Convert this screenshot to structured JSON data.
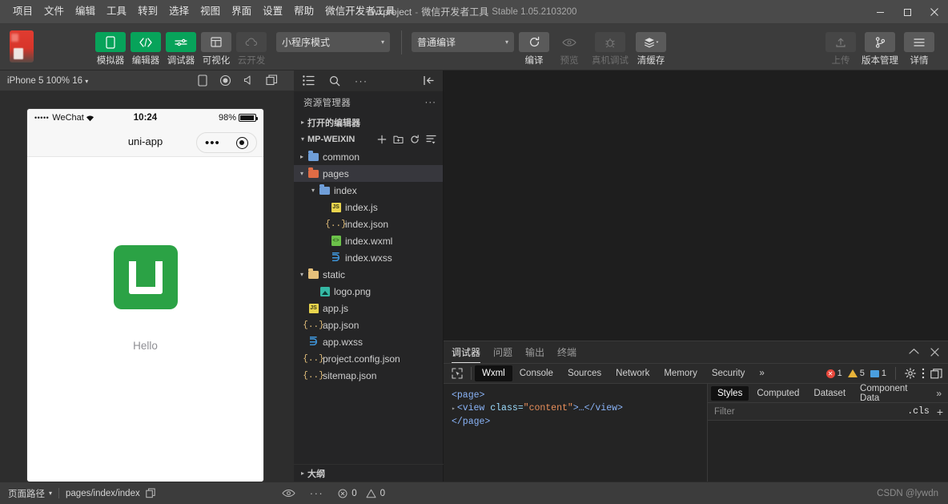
{
  "titlebar": {
    "menus": [
      "项目",
      "文件",
      "编辑",
      "工具",
      "转到",
      "选择",
      "视图",
      "界面",
      "设置",
      "帮助",
      "微信开发者工具"
    ],
    "project_name": "wxproject",
    "dash": "-",
    "app_name": "微信开发者工具",
    "version": "Stable 1.05.2103200",
    "controls": {
      "minimize": "minimize-icon",
      "maximize": "maximize-icon",
      "close": "close-icon"
    }
  },
  "toolbar": {
    "buttons": [
      {
        "label": "模拟器",
        "icon": "phone-icon",
        "state": "green"
      },
      {
        "label": "编辑器",
        "icon": "code-icon",
        "state": "green"
      },
      {
        "label": "调试器",
        "icon": "debug-icon",
        "state": "green"
      },
      {
        "label": "可视化",
        "icon": "layout-icon",
        "state": "grey"
      },
      {
        "label": "云开发",
        "icon": "cloud-icon",
        "state": "disabled"
      }
    ],
    "mode_select": {
      "value": "小程序模式",
      "caret": "▾"
    },
    "compile_select": {
      "value": "普通编译",
      "caret": "▾"
    },
    "actions": [
      {
        "label": "编译",
        "icon": "refresh-icon",
        "state": "normal"
      },
      {
        "label": "预览",
        "icon": "eye-icon",
        "state": "disabled"
      },
      {
        "label": "真机调试",
        "icon": "bug-icon",
        "state": "disabled"
      },
      {
        "label": "清缓存",
        "icon": "layers-icon",
        "state": "normal",
        "caret": "▾"
      }
    ],
    "right_actions": [
      {
        "label": "上传",
        "icon": "upload-icon",
        "state": "disabled"
      },
      {
        "label": "版本管理",
        "icon": "branch-icon",
        "state": "normal"
      },
      {
        "label": "详情",
        "icon": "menu-icon",
        "state": "normal"
      }
    ]
  },
  "simulator": {
    "device_label": "iPhone 5 100% 16",
    "device_caret": "▾",
    "icons": [
      "device-rotate-icon",
      "record-icon",
      "volume-icon",
      "window-icon"
    ],
    "phone": {
      "status": {
        "signal": "•••••",
        "carrier": "WeChat",
        "wifi": "wifi-icon",
        "time": "10:24",
        "battery_pct": "98%"
      },
      "nav_title": "uni-app",
      "capsule": {
        "dots": "•••",
        "target": "target-icon"
      },
      "content": {
        "logo": "uni-app-logo",
        "logo_color": "#2ba245",
        "text": "Hello"
      }
    }
  },
  "explorer": {
    "tool_icons": [
      "list-icon",
      "search-icon",
      "more-icon",
      "collapse-panel-icon"
    ],
    "header": "资源管理器",
    "header_more": "···",
    "sections": [
      {
        "label": "打开的编辑器",
        "expanded": false,
        "arrow": "▸"
      },
      {
        "label": "MP-WEIXIN",
        "expanded": true,
        "arrow": "▾",
        "actions": [
          "new-file-icon",
          "new-folder-icon",
          "refresh-icon",
          "collapse-all-icon"
        ]
      }
    ],
    "tree": [
      {
        "name": "common",
        "type": "folder",
        "color": "blue",
        "indent": 1,
        "arrow": "▸",
        "selected": false
      },
      {
        "name": "pages",
        "type": "folder",
        "color": "orange",
        "indent": 1,
        "arrow": "▾",
        "selected": true
      },
      {
        "name": "index",
        "type": "folder",
        "color": "blue",
        "indent": 2,
        "arrow": "▾",
        "selected": false
      },
      {
        "name": "index.js",
        "type": "js",
        "indent": 3,
        "arrow": "",
        "selected": false
      },
      {
        "name": "index.json",
        "type": "json",
        "indent": 3,
        "arrow": "",
        "selected": false
      },
      {
        "name": "index.wxml",
        "type": "wxml",
        "indent": 3,
        "arrow": "",
        "selected": false
      },
      {
        "name": "index.wxss",
        "type": "wxss",
        "indent": 3,
        "arrow": "",
        "selected": false
      },
      {
        "name": "static",
        "type": "folder",
        "color": "yellow",
        "indent": 1,
        "arrow": "▾",
        "selected": false
      },
      {
        "name": "logo.png",
        "type": "png",
        "indent": 2,
        "arrow": "",
        "selected": false
      },
      {
        "name": "app.js",
        "type": "js",
        "indent": 1,
        "arrow": "",
        "selected": false
      },
      {
        "name": "app.json",
        "type": "json",
        "indent": 1,
        "arrow": "",
        "selected": false
      },
      {
        "name": "app.wxss",
        "type": "wxss",
        "indent": 1,
        "arrow": "",
        "selected": false
      },
      {
        "name": "project.config.json",
        "type": "json",
        "indent": 1,
        "arrow": "",
        "selected": false
      },
      {
        "name": "sitemap.json",
        "type": "json",
        "indent": 1,
        "arrow": "",
        "selected": false
      }
    ],
    "outline": {
      "label": "大纲",
      "arrow": "▸"
    }
  },
  "debugger": {
    "panel_tabs": [
      {
        "label": "调试器",
        "active": true
      },
      {
        "label": "问题",
        "active": false
      },
      {
        "label": "输出",
        "active": false
      },
      {
        "label": "终端",
        "active": false
      }
    ],
    "panel_ctrls": [
      "collapse-icon",
      "close-icon"
    ],
    "devtools": {
      "inspect_icon": "inspect-element-icon",
      "tabs": [
        {
          "label": "Wxml",
          "active": true
        },
        {
          "label": "Console",
          "active": false
        },
        {
          "label": "Sources",
          "active": false
        },
        {
          "label": "Network",
          "active": false
        },
        {
          "label": "Memory",
          "active": false
        },
        {
          "label": "Security",
          "active": false
        }
      ],
      "overflow": "»",
      "counts": {
        "errors": "1",
        "warnings": "5",
        "infos": "1"
      },
      "right_icons": [
        "settings-icon",
        "kebab-menu-icon",
        "dock-icon"
      ]
    },
    "wxml": {
      "line1_open": "<page>",
      "line2_arrow": "▸",
      "line2_tag_open": "<view ",
      "line2_attr": "class=",
      "line2_value": "\"content\"",
      "line2_tag_close": ">…</view>",
      "line3_close": "</page>"
    },
    "styles": {
      "tabs": [
        {
          "label": "Styles",
          "active": true
        },
        {
          "label": "Computed",
          "active": false
        },
        {
          "label": "Dataset",
          "active": false
        },
        {
          "label": "Component Data",
          "active": false
        }
      ],
      "overflow": "»",
      "filter_placeholder": "Filter",
      "filter_value": "",
      "cls_label": ".cls",
      "plus_label": "+"
    }
  },
  "statusbar": {
    "page_path_label": "页面路径",
    "page_path_caret": "▾",
    "page_path_value": "pages/index/index",
    "copy_icon": "copy-icon",
    "right_icons": [
      "eye-icon",
      "more-icon"
    ],
    "problems": {
      "errors": "0",
      "warnings": "0"
    },
    "watermark": "CSDN @lywdn"
  },
  "colors": {
    "accent_green": "#07a35a",
    "logo_green": "#2ba245",
    "error_red": "#e8483c",
    "warn_yellow": "#e8b339",
    "info_blue": "#4a9fe0",
    "titlebar_bg": "#4a4a4a",
    "toolbar_bg": "#3c3c3c",
    "editor_bg": "#1e1e1e",
    "sidebar_bg": "#252526"
  }
}
